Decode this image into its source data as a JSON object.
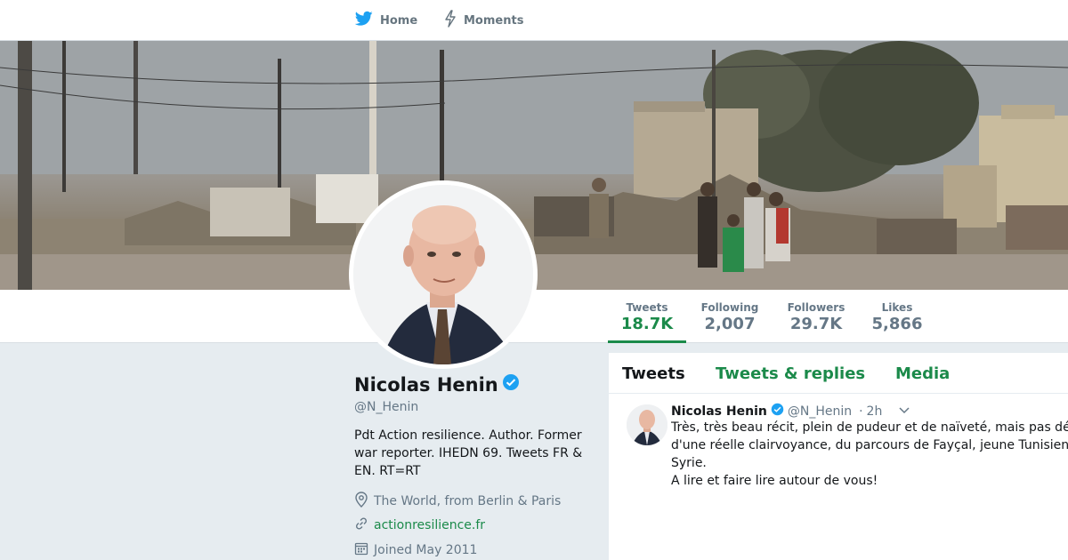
{
  "nav": {
    "home_label": "Home",
    "moments_label": "Moments"
  },
  "stats": [
    {
      "label": "Tweets",
      "value": "18.7K"
    },
    {
      "label": "Following",
      "value": "2,007"
    },
    {
      "label": "Followers",
      "value": "29.7K"
    },
    {
      "label": "Likes",
      "value": "5,866"
    }
  ],
  "profile": {
    "name": "Nicolas Henin",
    "handle": "@N_Henin",
    "bio": "Pdt Action resilience. Author. Former war reporter. IHEDN 69. Tweets FR & EN. RT=RT",
    "location": "The World, from Berlin & Paris",
    "url": "actionresilience.fr",
    "joined": "Joined May 2011"
  },
  "timeline": {
    "tabs": [
      "Tweets",
      "Tweets & replies",
      "Media"
    ],
    "tweet": {
      "name": "Nicolas Henin",
      "handle": "@N_Henin",
      "separator": "·",
      "time": "2h",
      "lines": [
        "Très, très beau récit, plein de pudeur et de naïveté, mais pas dé",
        "d'une réelle clairvoyance, du parcours de Fayçal, jeune Tunisien",
        "Syrie.",
        "A lire et faire lire autour de vous!"
      ]
    }
  },
  "colors": {
    "accent": "#1b8a4a",
    "verified": "#1da1f2",
    "muted": "#657786",
    "page_bg": "#e6ecf0"
  },
  "icons": {
    "home": "bird-icon",
    "moments": "lightning-icon",
    "verified": "verified-badge-icon",
    "location": "map-pin-icon",
    "url": "link-icon",
    "joined": "calendar-icon",
    "caret": "chevron-down-icon"
  }
}
